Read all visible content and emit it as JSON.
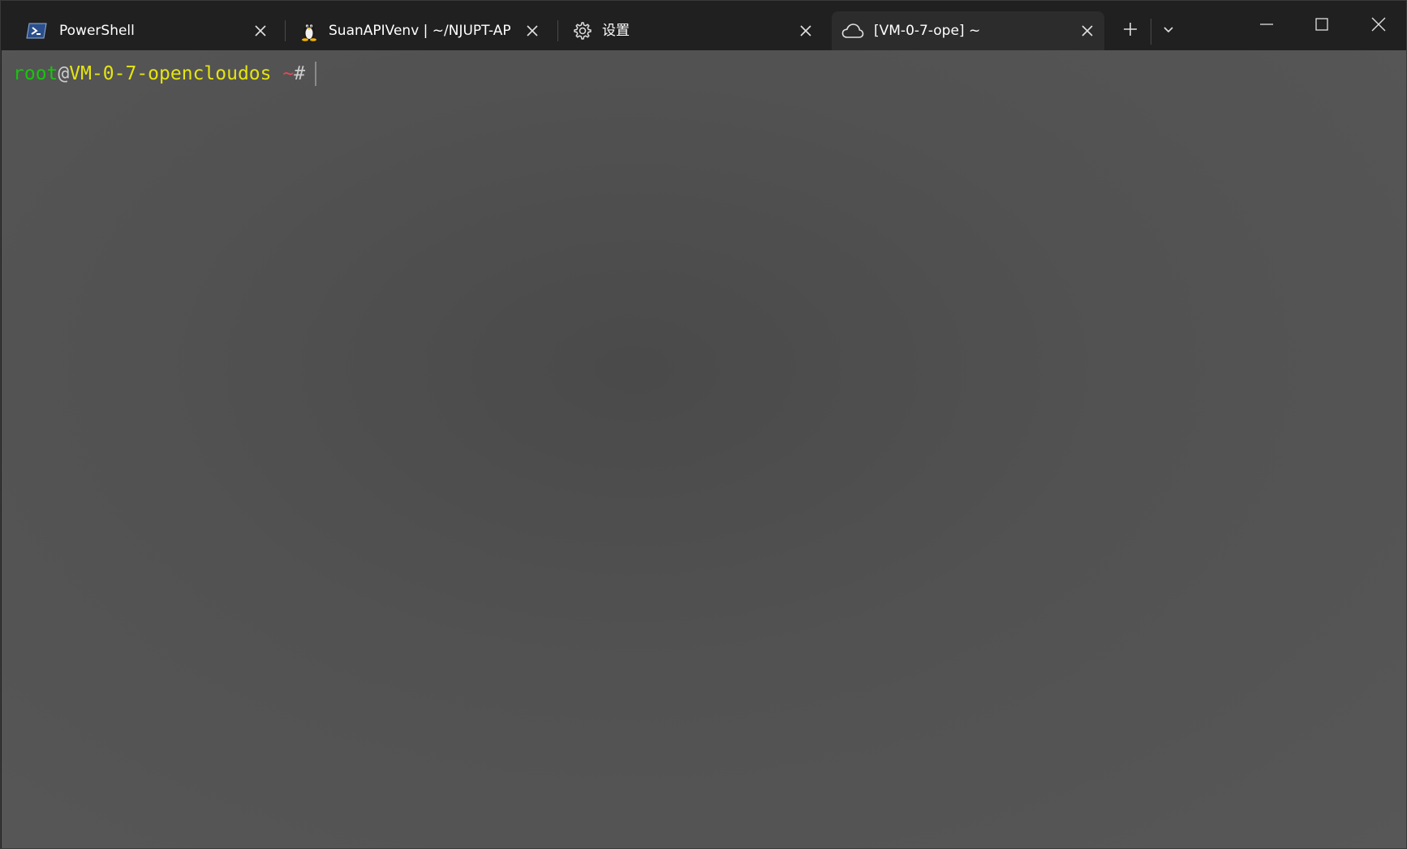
{
  "tabs": [
    {
      "label": "PowerShell",
      "icon": "powershell-icon",
      "active": false
    },
    {
      "label": "SuanAPIVenv | ~/NJUPT-API",
      "icon": "linux-penguin-icon",
      "active": false
    },
    {
      "label": "设置",
      "icon": "gear-icon",
      "active": false
    },
    {
      "label": "[VM-0-7-ope] ~",
      "icon": "cloud-icon",
      "active": true
    }
  ],
  "tabbar": {
    "new_tab_icon": "plus-icon",
    "dropdown_icon": "chevron-down-icon"
  },
  "window_controls": {
    "minimize_icon": "minimize-icon",
    "maximize_icon": "maximize-icon",
    "close_icon": "close-icon"
  },
  "terminal": {
    "prompt_user": "root",
    "prompt_at": "@",
    "prompt_host": "VM-0-7-opencloudos",
    "prompt_path": "~",
    "prompt_symbol": "#",
    "colors": {
      "user": "#16c60c",
      "host": "#e5e510",
      "path": "#e74856",
      "symbol": "#cccccc"
    }
  }
}
